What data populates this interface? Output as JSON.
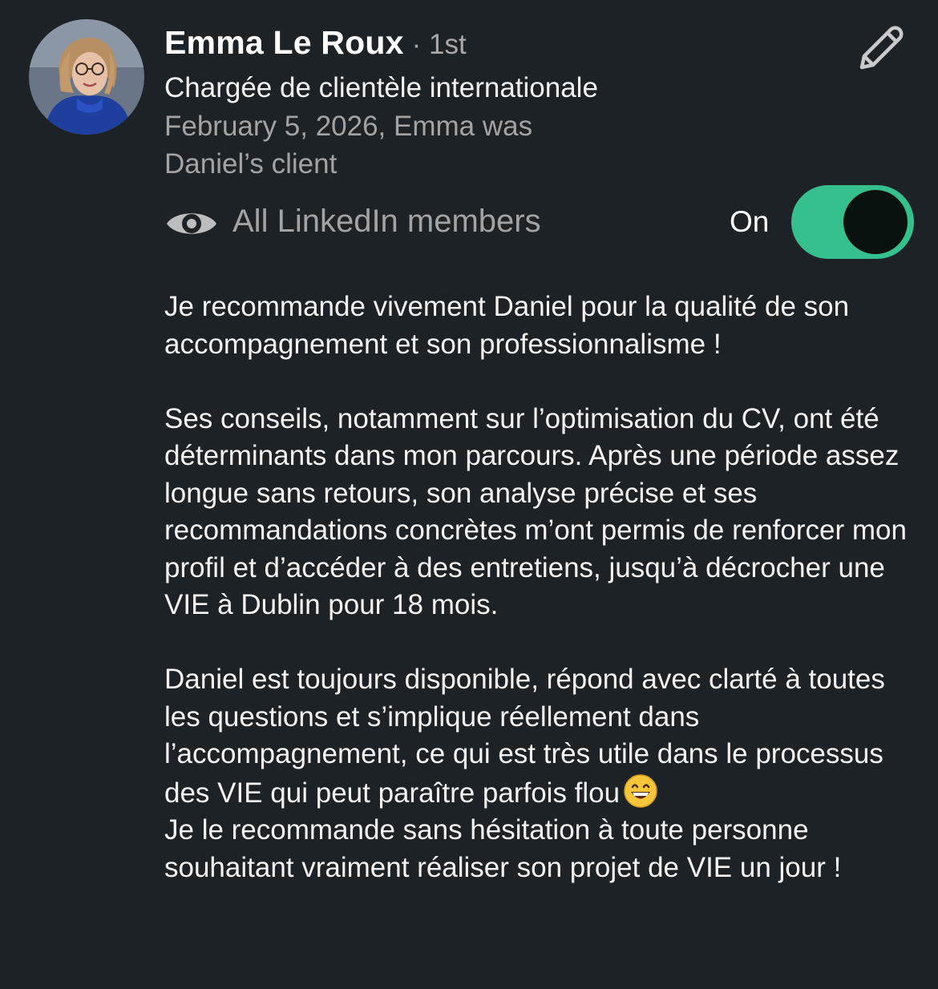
{
  "author": {
    "name": "Emma Le Roux",
    "degree": "· 1st",
    "headline": "Chargée de clientèle internationale",
    "relationship_line1": "February 5, 2026, Emma was",
    "relationship_line2": "Daniel’s client"
  },
  "visibility": {
    "icon": "eye-icon",
    "label": "All LinkedIn members",
    "toggle_label": "On",
    "toggle_on": true,
    "toggle_color": "#36c08e"
  },
  "recommendation": {
    "paragraph1": "Je recommande vivement Daniel pour la qualité de son accompagnement et son professionnalisme !",
    "paragraph2": "Ses conseils, notamment sur l’optimisation du CV, ont été déterminants dans mon parcours. Après une période assez longue sans retours, son analyse précise et ses recommandations concrètes m’ont permis de renforcer mon profil et d’accéder à des entretiens, jusqu’à décrocher une VIE à Dublin pour 18 mois.",
    "paragraph3a": "Daniel est toujours disponible, répond avec clarté à toutes les questions et s’implique réellement dans l’accompagnement, ce qui est très utile dans le processus des VIE qui peut paraître parfois flou",
    "paragraph3b": "Je le recommande sans hésitation à toute personne souhaitant vraiment réaliser son projet de VIE un jour !"
  },
  "icons": {
    "edit": "pencil-icon",
    "emoji": "grinning-face-emoji"
  },
  "colors": {
    "background": "#1d2226",
    "accent_green": "#36c08e",
    "muted_text": "#a2a3a4"
  }
}
